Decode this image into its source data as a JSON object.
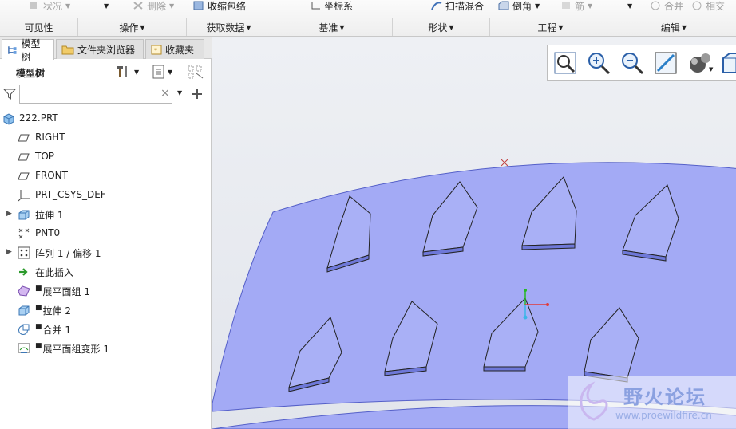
{
  "ribbon": {
    "top_commands": [
      {
        "label": "状况",
        "disabled": true
      },
      {
        "label": "删除",
        "disabled": true
      },
      {
        "label": "收缩包络",
        "disabled": false
      },
      {
        "label": "坐标系",
        "disabled": false
      },
      {
        "label": "扫描混合",
        "disabled": false
      },
      {
        "label": "倒角",
        "disabled": false
      },
      {
        "label": "筋",
        "disabled": true
      },
      {
        "label": "合并",
        "disabled": true
      },
      {
        "label": "相交",
        "disabled": true
      }
    ],
    "groups": [
      {
        "label": "可见性",
        "has_dropdown": false
      },
      {
        "label": "操作",
        "has_dropdown": true
      },
      {
        "label": "获取数据",
        "has_dropdown": true
      },
      {
        "label": "基准",
        "has_dropdown": true
      },
      {
        "label": "形状",
        "has_dropdown": true
      },
      {
        "label": "工程",
        "has_dropdown": true
      },
      {
        "label": "编辑",
        "has_dropdown": true
      }
    ]
  },
  "panel": {
    "tabs": [
      {
        "label": "模型树",
        "active": true,
        "icon": "model-tree-icon"
      },
      {
        "label": "文件夹浏览器",
        "active": false,
        "icon": "folder-browser-icon"
      },
      {
        "label": "收藏夹",
        "active": false,
        "icon": "favorites-icon"
      }
    ],
    "title": "模型树",
    "filter": {
      "value": "",
      "placeholder": ""
    },
    "tree": [
      {
        "label": "222.PRT",
        "icon": "part-icon",
        "expandable": false,
        "indent": 0,
        "marked": false
      },
      {
        "label": "RIGHT",
        "icon": "datum-plane-icon",
        "expandable": false,
        "indent": 1,
        "marked": false
      },
      {
        "label": "TOP",
        "icon": "datum-plane-icon",
        "expandable": false,
        "indent": 1,
        "marked": false
      },
      {
        "label": "FRONT",
        "icon": "datum-plane-icon",
        "expandable": false,
        "indent": 1,
        "marked": false
      },
      {
        "label": "PRT_CSYS_DEF",
        "icon": "csys-icon",
        "expandable": false,
        "indent": 1,
        "marked": false
      },
      {
        "label": "拉伸 1",
        "icon": "extrude-icon",
        "expandable": true,
        "indent": 1,
        "marked": false
      },
      {
        "label": "PNT0",
        "icon": "datum-point-icon",
        "expandable": false,
        "indent": 1,
        "marked": false
      },
      {
        "label": "阵列 1 / 偏移 1",
        "icon": "pattern-icon",
        "expandable": true,
        "indent": 1,
        "marked": false
      },
      {
        "label": "在此插入",
        "icon": "insert-arrow-icon",
        "expandable": false,
        "indent": 1,
        "marked": false
      },
      {
        "label": "展平面组 1",
        "icon": "flatten-quilt-icon",
        "expandable": false,
        "indent": 1,
        "marked": true
      },
      {
        "label": "拉伸 2",
        "icon": "extrude-icon",
        "expandable": false,
        "indent": 1,
        "marked": true
      },
      {
        "label": "合并 1",
        "icon": "merge-icon",
        "expandable": false,
        "indent": 1,
        "marked": true
      },
      {
        "label": "展平面组变形 1",
        "icon": "flatten-deform-icon",
        "expandable": false,
        "indent": 1,
        "marked": true
      }
    ]
  },
  "viewport": {
    "toolbar": [
      {
        "name": "refit-button",
        "icon": "refit-icon"
      },
      {
        "name": "zoom-in-button",
        "icon": "zoom-in-icon"
      },
      {
        "name": "zoom-out-button",
        "icon": "zoom-out-icon"
      },
      {
        "name": "repaint-button",
        "icon": "repaint-icon"
      },
      {
        "name": "display-style-button",
        "icon": "display-style-icon"
      },
      {
        "name": "saved-views-button",
        "icon": "saved-views-icon"
      }
    ],
    "colors": {
      "surface": "#a3aaf5",
      "surface_edge": "#5560c8",
      "background": "#e6e9ef"
    },
    "watermark": {
      "title": "野火论坛",
      "url": "www.proewildfire.cn"
    }
  }
}
